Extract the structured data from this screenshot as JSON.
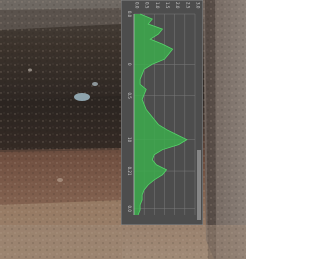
{
  "chart_data": {
    "type": "area",
    "orientation": "vertical-depth-profile",
    "title": "",
    "xlabel": "",
    "ylabel": "",
    "x_tick_labels": [
      "0.0",
      "0.5",
      "1.0",
      "1.5",
      "2.0",
      "2.5",
      "3.0"
    ],
    "y_tick_labels": [
      "0.0",
      "0",
      "0.5",
      "10",
      "0.21",
      "0.0"
    ],
    "y_tick_positions": [
      0,
      0.4,
      0.65,
      1.0,
      1.25,
      1.55
    ],
    "xlim": [
      0,
      3
    ],
    "ylim": [
      0,
      1.6
    ],
    "grid": true,
    "colors": {
      "panel": "#4d4d4d",
      "fill": "#3cab4c",
      "line": "#56d36a",
      "grid": "#7a7a7a",
      "text": "#d7d7d7"
    },
    "series": [
      {
        "depth": [
          0,
          0.04,
          0.08,
          0.12,
          0.16,
          0.2,
          0.24,
          0.28,
          0.32,
          0.36,
          0.4,
          0.44,
          0.48,
          0.52,
          0.56,
          0.6,
          0.64,
          0.68,
          0.72,
          0.76,
          0.8,
          0.84,
          0.88,
          0.92,
          0.96,
          1.0,
          1.04,
          1.08,
          1.12,
          1.16,
          1.2,
          1.24,
          1.28,
          1.32,
          1.36,
          1.4,
          1.44,
          1.48,
          1.52,
          1.56,
          1.6
        ],
        "values": [
          0.3,
          0.9,
          0.7,
          1.4,
          1.2,
          0.8,
          1.4,
          1.9,
          1.7,
          1.5,
          0.9,
          0.5,
          0.4,
          0.3,
          0.3,
          0.6,
          0.5,
          0.4,
          0.5,
          0.6,
          0.8,
          1.0,
          1.2,
          1.6,
          2.1,
          2.6,
          2.2,
          1.4,
          1.0,
          0.9,
          1.1,
          1.6,
          1.4,
          1.0,
          0.7,
          0.5,
          0.4,
          0.4,
          0.3,
          0.3,
          0.2
        ]
      }
    ]
  }
}
